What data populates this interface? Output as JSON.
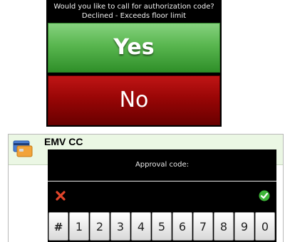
{
  "dialog": {
    "prompt": "Would you like to call for authorization code? Declined - Exceeds floor limit",
    "yes_label": "Yes",
    "no_label": "No"
  },
  "panel": {
    "title": "EMV CC",
    "approval_label": "Approval code:",
    "approval_value": "",
    "keys": [
      "#",
      "1",
      "2",
      "3",
      "4",
      "5",
      "6",
      "7",
      "8",
      "9",
      "0"
    ]
  },
  "icons": {
    "card": "credit-card-icon",
    "cancel": "close-icon",
    "confirm": "check-icon"
  },
  "colors": {
    "yes_green": "#59b64f",
    "no_red": "#990606",
    "header_bg": "#ebf7e4"
  }
}
